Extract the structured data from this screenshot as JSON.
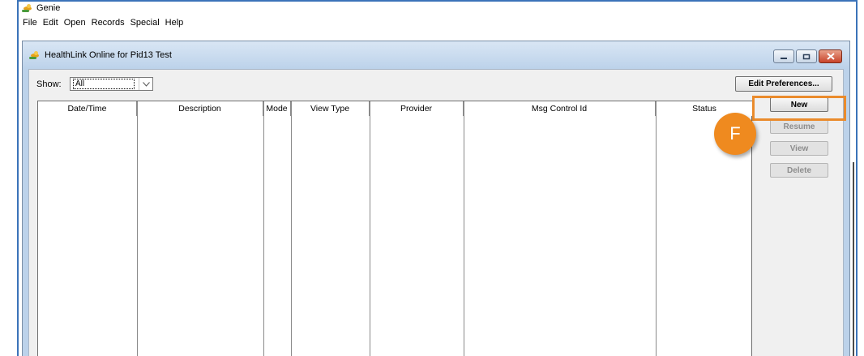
{
  "app": {
    "title": "Genie",
    "menu": [
      "File",
      "Edit",
      "Open",
      "Records",
      "Special",
      "Help"
    ]
  },
  "window": {
    "title": "HealthLink Online for Pid13 Test",
    "controls": [
      "minimize-icon",
      "restore-icon",
      "close-icon"
    ]
  },
  "filter": {
    "show_label": "Show:",
    "show_value": "All"
  },
  "toolbar": {
    "edit_preferences": "Edit Preferences..."
  },
  "table": {
    "columns": [
      "Date/Time",
      "Description",
      "Mode",
      "View Type",
      "Provider",
      "Msg Control Id",
      "Status"
    ],
    "rows": []
  },
  "actions": {
    "new": "New",
    "resume": "Resume",
    "view": "View",
    "delete": "Delete"
  },
  "annotation": {
    "callout_label": "F",
    "color": "#ea8b2c"
  }
}
